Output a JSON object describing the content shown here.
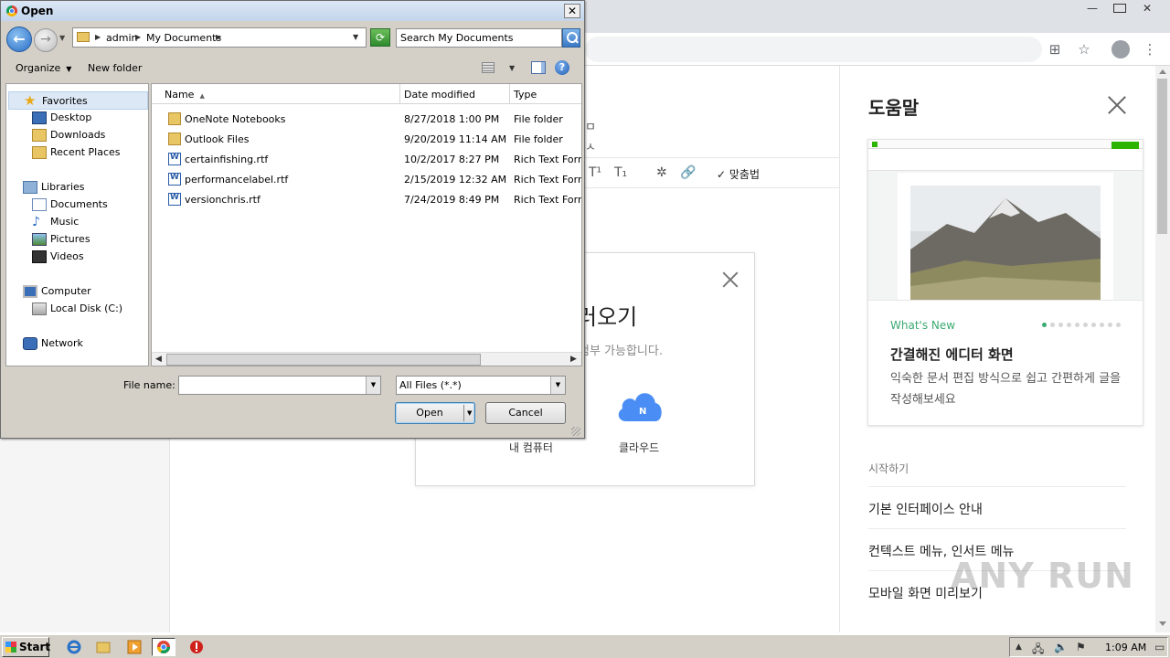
{
  "browser": {
    "help_panel": {
      "title": "도움말",
      "new_label": "What's New",
      "card_title": "간결해진 에디터 화면",
      "card_body": "익숙한 문서 편집 방식으로 쉽고 간편하게 글을 작성해보세요",
      "section_label": "시작하기",
      "links": [
        "기본 인터페이스 안내",
        "컨텍스트 메뉴, 인서트 메뉴",
        "모바일 화면 미리보기"
      ]
    },
    "upload_modal": {
      "title_fragment": "러오기",
      "subtitle_fragment": "첨부 가능합니다.",
      "pc_label": "내 컴퓨터",
      "cloud_label": "클라우드",
      "cloud_badge": "N"
    },
    "editor_toolbar": {
      "superscript": "T¹",
      "subscript": "T₁",
      "spellcheck": "맞춤법"
    },
    "watermark": "ANY RUN"
  },
  "dialog": {
    "title": "Open",
    "breadcrumb": [
      "admin",
      "My Documents"
    ],
    "search_placeholder": "Search My Documents",
    "toolbar": {
      "organize": "Organize",
      "new_folder": "New folder"
    },
    "nav_pane": {
      "favorites": "Favorites",
      "favorites_items": [
        "Desktop",
        "Downloads",
        "Recent Places"
      ],
      "libraries": "Libraries",
      "library_items": [
        "Documents",
        "Music",
        "Pictures",
        "Videos"
      ],
      "computer": "Computer",
      "computer_items": [
        "Local Disk (C:)"
      ],
      "network": "Network"
    },
    "columns": {
      "name": "Name",
      "date": "Date modified",
      "type": "Type"
    },
    "files": [
      {
        "name": "OneNote Notebooks",
        "date": "8/27/2018 1:00 PM",
        "type": "File folder",
        "kind": "folder"
      },
      {
        "name": "Outlook Files",
        "date": "9/20/2019 11:14 AM",
        "type": "File folder",
        "kind": "folder"
      },
      {
        "name": "certainfishing.rtf",
        "date": "10/2/2017 8:27 PM",
        "type": "Rich Text Format",
        "kind": "rtf"
      },
      {
        "name": "performancelabel.rtf",
        "date": "2/15/2019 12:32 AM",
        "type": "Rich Text Format",
        "kind": "rtf"
      },
      {
        "name": "versionchris.rtf",
        "date": "7/24/2019 8:49 PM",
        "type": "Rich Text Format",
        "kind": "rtf"
      }
    ],
    "file_name_label": "File name:",
    "file_name_value": "",
    "filter_value": "All Files (*.*)",
    "open_label": "Open",
    "cancel_label": "Cancel"
  },
  "taskbar": {
    "start_label": "Start",
    "clock": "1:09 AM"
  }
}
